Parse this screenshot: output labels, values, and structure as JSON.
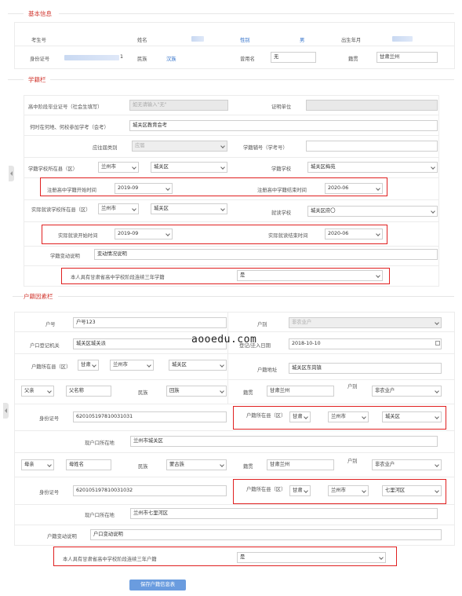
{
  "basic": {
    "title": "基本信息",
    "student_no_label": "考生号",
    "name_label": "姓名",
    "gender_label": "性别",
    "gender_value": "男",
    "birth_label": "出生年月",
    "id_label": "身份证号",
    "id_value_tail": "1",
    "ethnic_label": "民族",
    "ethnic_value": "汉族",
    "previous_name_label": "曾用名",
    "previous_name_value": "无",
    "native_label": "籍贯",
    "native_value": "甘肃兰州"
  },
  "school": {
    "title": "学籍栏",
    "school_reg_label": "高中阶段毕业证号（社会生填写）",
    "school_reg_placeholder": "如无请输入\"无\"",
    "cert_unit_label": "证明单位",
    "exam_loc_label": "何时在何地、何校参加学考（会考）",
    "exam_loc_value": "城关区教育会考",
    "category_label": "应往届类别",
    "category_value": "应届",
    "xk_no_label": "学籍辅号（学考号）",
    "county_label": "学籍学校所在县（区）",
    "county_city": "兰州市",
    "county_district": "城关区",
    "school_label": "学籍学校",
    "school_value": "城关区梅苑",
    "reg_start_label": "注册高中学籍开始时间",
    "reg_start_value": "2019-09",
    "reg_end_label": "注册高中学籍结束时间",
    "reg_end_value": "2020-06",
    "actual_county_label": "实际就读学校所在县（区）",
    "actual_city": "兰州市",
    "actual_district": "城关区",
    "actual_school_label": "就读学校",
    "actual_school_value": "城关区府〇",
    "actual_start_label": "实际就读开始时间",
    "actual_start_value": "2019-09",
    "actual_end_label": "实际就读结束时间",
    "actual_end_value": "2020-06",
    "change_label": "学籍变动说明",
    "change_value": "变动情况说明",
    "three_year_label": "本人具有甘肃省高中学校阶段连续三年学籍",
    "three_year_value": "是"
  },
  "hukou": {
    "title": "户籍因素栏",
    "hh_no_label": "户号",
    "hh_no_value": "户号123",
    "hh_type_label": "户别",
    "hh_type_value": "非农业户",
    "hh_office_label": "户口登记机关",
    "hh_office_value": "城关区城关派",
    "hh_date_label": "登记/迁入日期",
    "hh_date_value": "2018-10-10",
    "hh_county_label": "户籍所在县（区）",
    "hh_prov": "甘肃",
    "hh_city": "兰州市",
    "hh_district": "城关区",
    "hh_addr_label": "户籍地址",
    "hh_addr_value": "城关区东岗镇",
    "father_relation": "父亲",
    "father_name": "父名称",
    "father_ethnic_label": "民族",
    "father_ethnic": "回族",
    "father_native_label": "籍贯",
    "father_native": "甘肃兰州",
    "father_type_label": "户别",
    "father_type": "非农业户",
    "father_id_label": "身份证号",
    "father_id": "620105197810031031",
    "father_county_label": "户籍所在县（区）",
    "father_prov": "甘肃",
    "father_city": "兰州市",
    "father_district": "城关区",
    "father_addr_label": "现户口所在地",
    "father_addr": "兰州市城关区",
    "mother_relation": "母亲",
    "mother_name": "母姓名",
    "mother_ethnic_label": "民族",
    "mother_ethnic": "蒙古族",
    "mother_native_label": "籍贯",
    "mother_native": "甘肃兰州",
    "mother_type_label": "户别",
    "mother_type": "非农业户",
    "mother_id_label": "身份证号",
    "mother_id": "620105197810031032",
    "mother_county_label": "户籍所在县（区）",
    "mother_prov": "甘肃",
    "mother_city": "兰州市",
    "mother_district": "七里河区",
    "mother_addr_label": "现户口所在地",
    "mother_addr": "兰州市七里河区",
    "change_label": "户籍变动说明",
    "change_value": "户口变动说明",
    "three_year_label": "本人具有甘肃省高中学校阶段连续三年户籍",
    "three_year_value": "是"
  },
  "watermark": "aooedu.com",
  "save_button": "保存户籍信息表"
}
